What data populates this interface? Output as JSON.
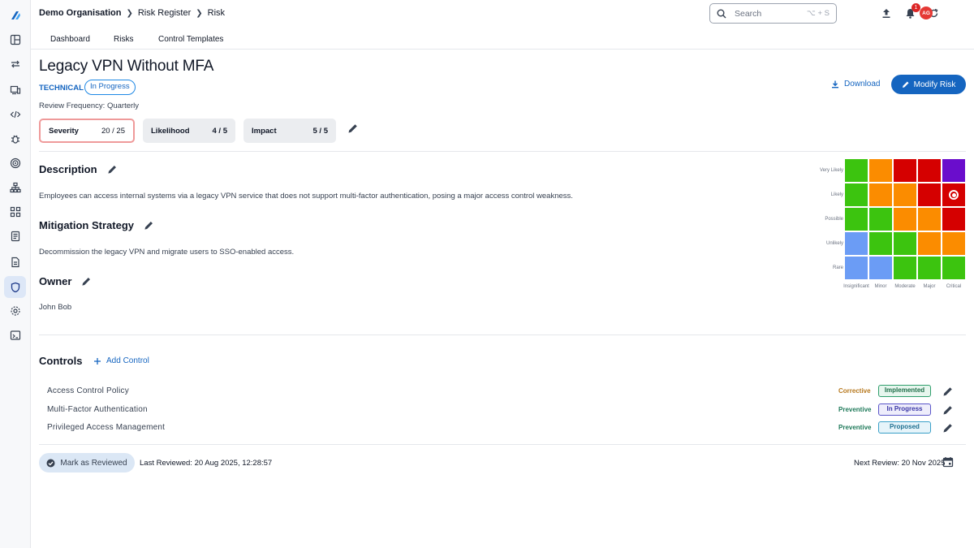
{
  "breadcrumb": {
    "org": "Demo Organisation",
    "section": "Risk Register",
    "page": "Risk"
  },
  "search": {
    "placeholder": "Search",
    "shortcut": "⌥ + S"
  },
  "notifications": {
    "count": "1"
  },
  "user": {
    "initials": "AG"
  },
  "tabs": [
    {
      "label": "Dashboard"
    },
    {
      "label": "Risks"
    },
    {
      "label": "Control Templates"
    }
  ],
  "risk": {
    "title": "Legacy VPN Without MFA",
    "category": "TECHNICAL",
    "status": "In Progress",
    "review_frequency": "Review Frequency: Quarterly",
    "metrics": {
      "severity": {
        "label": "Severity",
        "value": "20 / 25"
      },
      "likelihood": {
        "label": "Likelihood",
        "value": "4 / 5"
      },
      "impact": {
        "label": "Impact",
        "value": "5 / 5"
      }
    }
  },
  "actions": {
    "download": "Download",
    "modify": "Modify Risk"
  },
  "sections": {
    "description": {
      "title": "Description",
      "text": "Employees can access internal systems via a legacy VPN service that does not support multi-factor authentication, posing a major access control weakness."
    },
    "mitigation": {
      "title": "Mitigation Strategy",
      "text": "Decommission the legacy VPN and migrate users to SSO-enabled access."
    },
    "owner": {
      "title": "Owner",
      "text": "John Bob"
    }
  },
  "matrix": {
    "rows": [
      "Very Likely",
      "Likely",
      "Possible",
      "Unlikely",
      "Rare"
    ],
    "cols": [
      "Insignificant",
      "Minor",
      "Moderate",
      "Major",
      "Critical"
    ],
    "colors": {
      "green": "#3cc40f",
      "orange": "#fb8c00",
      "red": "#d50000",
      "purple": "#6a0dcc",
      "blue": "#6b9cf5"
    },
    "grid": [
      [
        "green",
        "orange",
        "red",
        "red",
        "purple"
      ],
      [
        "green",
        "orange",
        "orange",
        "red",
        "red"
      ],
      [
        "green",
        "green",
        "orange",
        "orange",
        "red"
      ],
      [
        "blue",
        "green",
        "green",
        "orange",
        "orange"
      ],
      [
        "blue",
        "blue",
        "green",
        "green",
        "green"
      ]
    ],
    "marker": {
      "row": "Likely",
      "col": "Critical"
    }
  },
  "controls": {
    "title": "Controls",
    "add_label": "Add Control",
    "items": [
      {
        "name": "Access Control Policy",
        "type": "Corrective",
        "status": "Implemented"
      },
      {
        "name": "Multi-Factor Authentication",
        "type": "Preventive",
        "status": "In Progress"
      },
      {
        "name": "Privileged Access Management",
        "type": "Preventive",
        "status": "Proposed"
      }
    ]
  },
  "footer": {
    "mark_reviewed": "Mark as Reviewed",
    "last_reviewed": "Last Reviewed: 20 Aug 2025, 12:28:57",
    "next_review": "Next Review: 20 Nov 2025"
  }
}
